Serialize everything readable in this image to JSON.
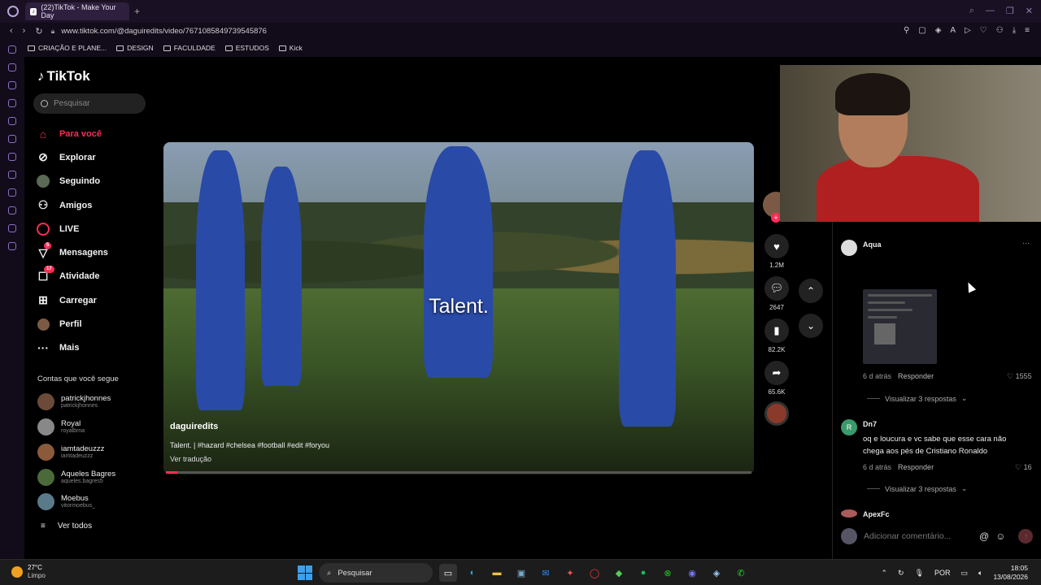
{
  "browser": {
    "tab_title": "(22)TikTok - Make Your Day",
    "url": "www.tiktok.com/@daguiredits/video/7671085849739545876",
    "bookmarks": [
      "CRIAÇÃO E PLANE...",
      "DESIGN",
      "FACULDADE",
      "ESTUDOS",
      "Kick"
    ]
  },
  "tiktok": {
    "logo": "TikTok",
    "search_placeholder": "Pesquisar",
    "menu": [
      {
        "label": "Para você",
        "icon": "home-icon"
      },
      {
        "label": "Explorar",
        "icon": "compass-icon"
      },
      {
        "label": "Seguindo",
        "icon": "following-icon"
      },
      {
        "label": "Amigos",
        "icon": "friends-icon"
      },
      {
        "label": "LIVE",
        "icon": "live-icon"
      },
      {
        "label": "Mensagens",
        "icon": "messages-icon",
        "badge": "5"
      },
      {
        "label": "Atividade",
        "icon": "activity-icon",
        "badge": "17"
      },
      {
        "label": "Carregar",
        "icon": "upload-icon"
      },
      {
        "label": "Perfil",
        "icon": "profile-icon"
      },
      {
        "label": "Mais",
        "icon": "more-icon"
      }
    ],
    "following_title": "Contas que você segue",
    "following": [
      {
        "name": "patrickjhonnes",
        "handle": "patrickjhonnes"
      },
      {
        "name": "Royal",
        "handle": "royalbrna"
      },
      {
        "name": "iamtadeuzzz",
        "handle": "iamtadeuzzz"
      },
      {
        "name": "Aqueles Bagres",
        "handle": "aqueles.bagres5"
      },
      {
        "name": "Moebus",
        "handle": "vitormoebus_"
      }
    ],
    "see_all": "Ver todos"
  },
  "video": {
    "caption_overlay": "Talent.",
    "author": "daguiredits",
    "description": "Talent. | #hazard #chelsea #football #edit #foryou",
    "translate": "Ver tradução",
    "progress": 0.02,
    "likes": "1.2M",
    "comments": "2647",
    "saves": "82.2K",
    "shares": "65.6K"
  },
  "comments": [
    {
      "user": "Aqua",
      "age": "6 d atrás",
      "reply": "Responder",
      "likes": "1555",
      "more_replies": "Visualizar 3 respostas"
    },
    {
      "user": "Dn7",
      "text": "oq e loucura e vc sabe que esse cara não chega aos pés de Cristiano Ronaldo",
      "age": "6 d atrás",
      "reply": "Responder",
      "likes": "16",
      "more_replies": "Visualizar 3 respostas"
    },
    {
      "user": "ApexFc"
    }
  ],
  "comment_input_placeholder": "Adicionar comentário...",
  "taskbar": {
    "temp": "27°C",
    "condition": "Limpo",
    "search": "Pesquisar",
    "lang": "POR",
    "time": "18:05",
    "date": "13/08/2026"
  },
  "colors": {
    "accent": "#fe2c55",
    "background": "#000000"
  }
}
